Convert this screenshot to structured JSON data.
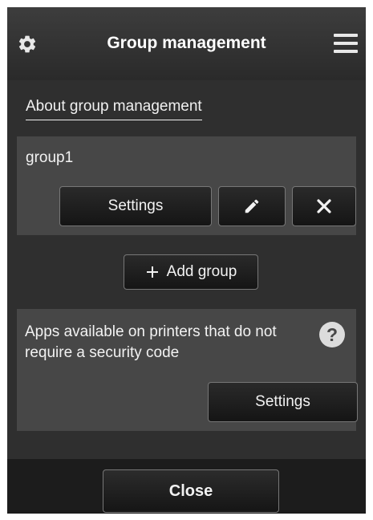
{
  "header": {
    "title": "Group management",
    "settings_icon": "gear-icon",
    "menu_icon": "hamburger-menu-icon"
  },
  "about_link": "About group management",
  "groups": [
    {
      "name": "group1",
      "settings_label": "Settings",
      "edit_icon": "pencil-icon",
      "delete_icon": "close-icon"
    }
  ],
  "add_group": {
    "icon": "plus-icon",
    "label": "Add group"
  },
  "apps_panel": {
    "text": "Apps available on printers that do not require a security code",
    "help_icon": "question-mark-icon",
    "help_glyph": "?",
    "settings_label": "Settings"
  },
  "footer": {
    "close_label": "Close"
  },
  "colors": {
    "background": "#2f2f2f",
    "panel": "#474747",
    "footer": "#1c1c1c",
    "text": "#f2f2f2",
    "button_border": "#777777"
  }
}
